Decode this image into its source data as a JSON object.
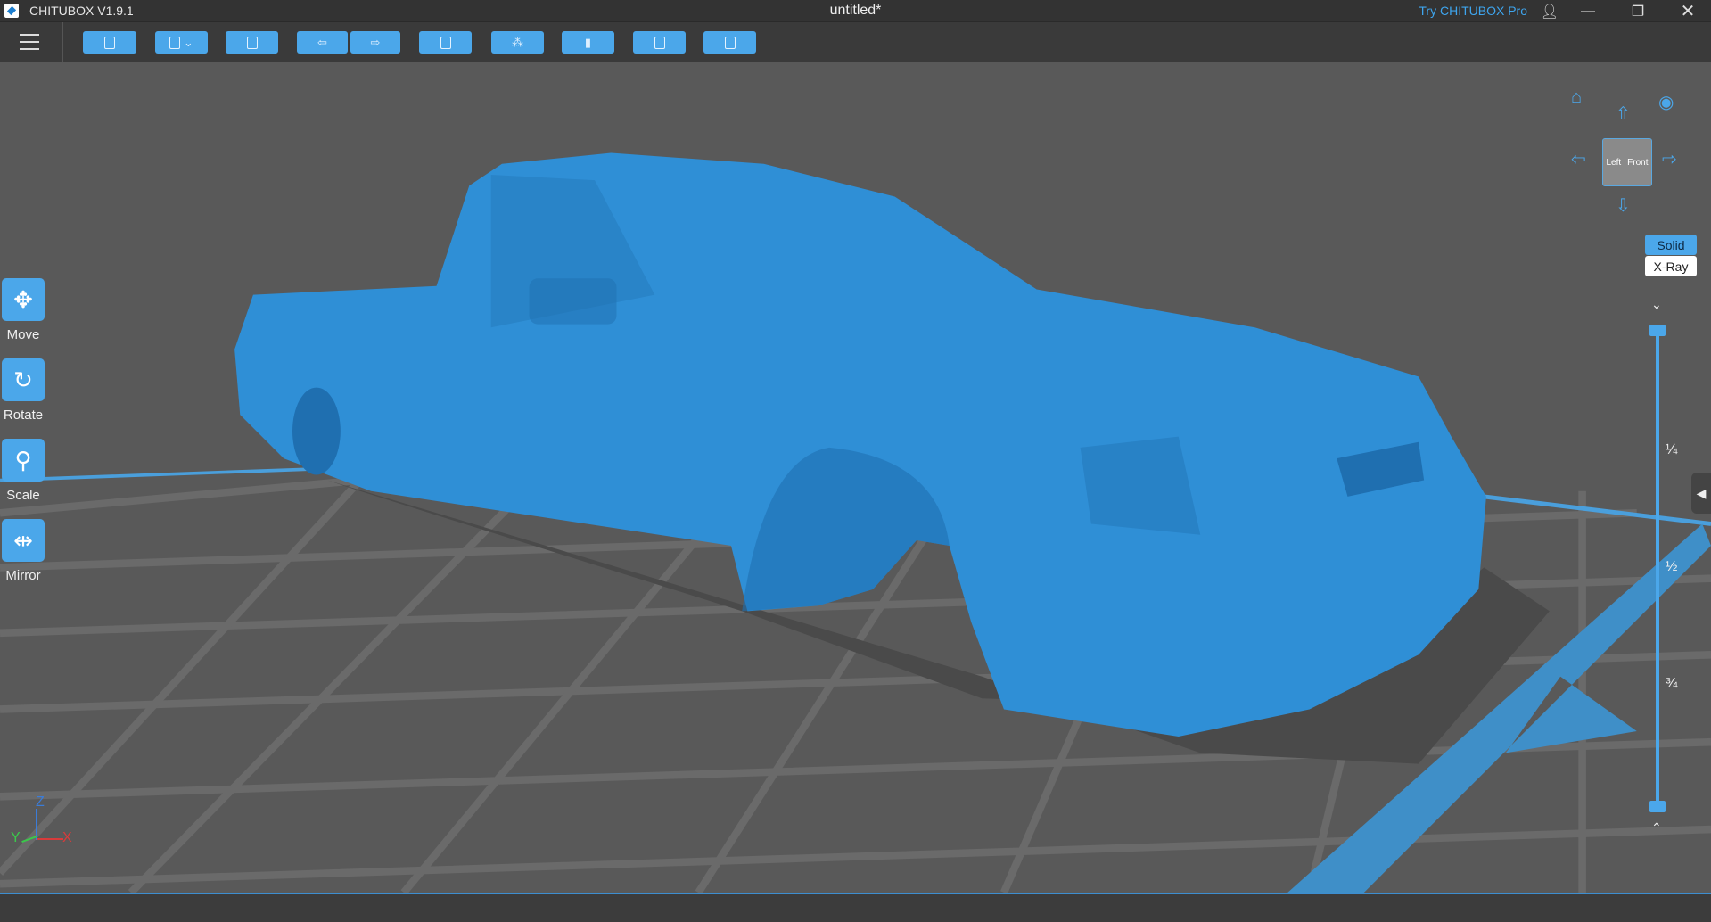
{
  "titlebar": {
    "app_name": "CHITUBOX V1.9.1",
    "document": "untitled*",
    "try_pro": "Try CHITUBOX Pro"
  },
  "toolbar": {
    "buttons": [
      "open",
      "save",
      "auto-layout",
      "undo",
      "redo",
      "slice-settings",
      "support",
      "hollow",
      "dig-hole",
      "print"
    ]
  },
  "tools": [
    {
      "label": "Move"
    },
    {
      "label": "Rotate"
    },
    {
      "label": "Scale"
    },
    {
      "label": "Mirror"
    }
  ],
  "view": {
    "cube_left": "Left",
    "cube_front": "Front",
    "solid": "Solid",
    "xray": "X-Ray"
  },
  "slider": {
    "marks": [
      "¼",
      "½",
      "¾"
    ],
    "top_value": 1,
    "bottom_value": 0
  },
  "axes": {
    "x": "X",
    "y": "Y",
    "z": "Z"
  },
  "colors": {
    "accent": "#4ba7ea",
    "model": "#2f8fd6",
    "background": "#595959"
  }
}
